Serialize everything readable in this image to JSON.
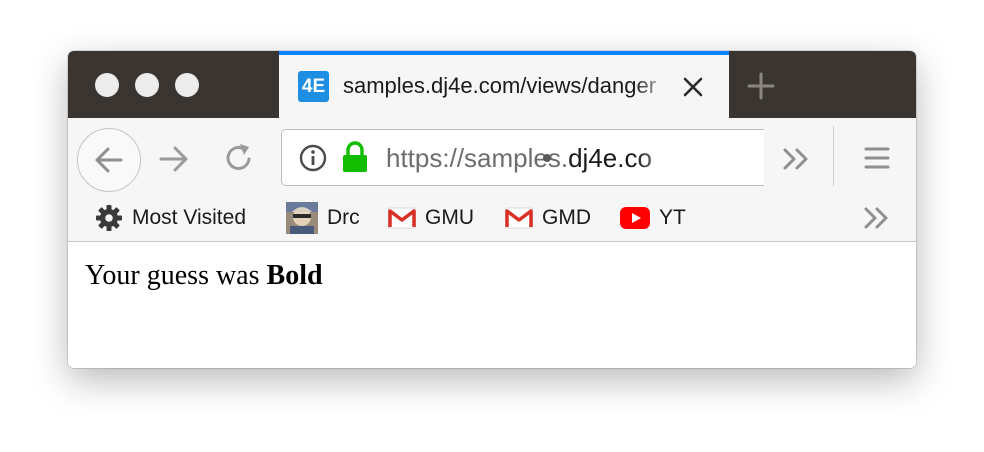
{
  "browser": {
    "tab": {
      "favicon_text": "4E",
      "title": "samples.dj4e.com/views/danger",
      "accent_color": "#0a84ff"
    },
    "url": {
      "scheme": "https://samples.",
      "host": "dj4e.co",
      "security": "secure-lock"
    },
    "bookmarks": [
      {
        "label": "Most Visited",
        "icon": "gear-icon"
      },
      {
        "label": "Drc",
        "icon": "avatar-favicon"
      },
      {
        "label": "GMU",
        "icon": "gmail-icon"
      },
      {
        "label": "GMD",
        "icon": "gmail-icon"
      },
      {
        "label": "YT",
        "icon": "youtube-icon"
      }
    ]
  },
  "page": {
    "prefix": "Your guess was ",
    "guess": "Bold"
  }
}
